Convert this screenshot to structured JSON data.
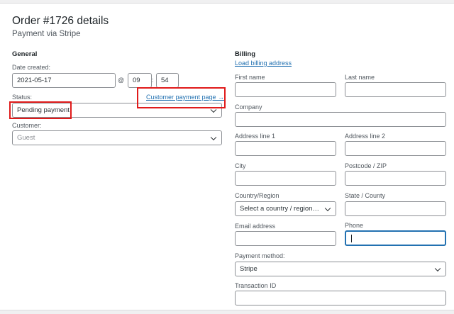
{
  "header": {
    "title": "Order #1726 details",
    "subtitle": "Payment via Stripe"
  },
  "general": {
    "heading": "General",
    "date_label": "Date created:",
    "date_value": "2021-05-17",
    "at_symbol": "@",
    "hour_value": "09",
    "time_colon": ":",
    "minute_value": "54",
    "status_label": "Status:",
    "status_value": "Pending payment",
    "payment_page_link": "Customer payment page →",
    "customer_label": "Customer:",
    "customer_placeholder": "Guest"
  },
  "billing": {
    "heading": "Billing",
    "load_link": "Load billing address",
    "first_name_label": "First name",
    "last_name_label": "Last name",
    "company_label": "Company",
    "address1_label": "Address line 1",
    "address2_label": "Address line 2",
    "city_label": "City",
    "postcode_label": "Postcode / ZIP",
    "country_label": "Country/Region",
    "country_value": "Select a country / region…",
    "state_label": "State / County",
    "email_label": "Email address",
    "phone_label": "Phone",
    "payment_method_label": "Payment method:",
    "payment_method_value": "Stripe",
    "transaction_label": "Transaction ID"
  },
  "colors": {
    "link": "#2271b1",
    "highlight": "#e01b1b",
    "focus": "#2271b1"
  },
  "icons": {
    "select_arrow": "chevron-down-icon",
    "text_cursor": "text-cursor-icon"
  }
}
